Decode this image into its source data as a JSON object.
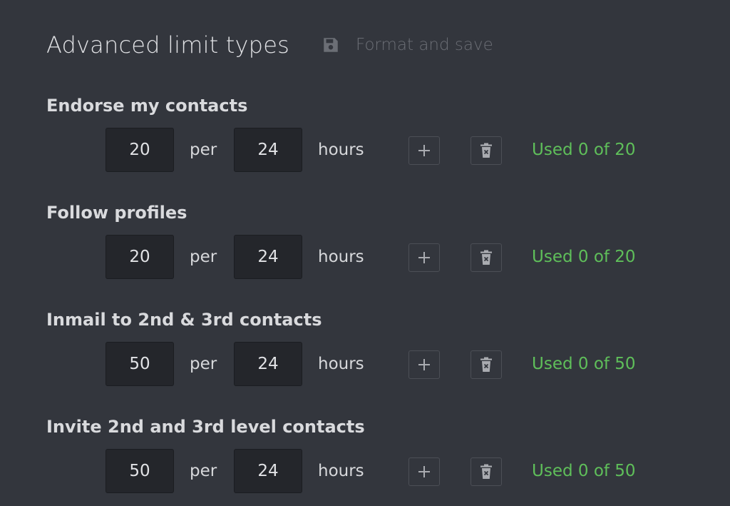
{
  "header": {
    "title": "Advanced limit types",
    "save_label": "Format and save",
    "save_icon": "floppy-disk-icon"
  },
  "labels": {
    "per": "per",
    "unit": "hours"
  },
  "limits": [
    {
      "label": "Endorse my contacts",
      "count": "20",
      "period": "24",
      "usage": "Used 0 of 20"
    },
    {
      "label": "Follow profiles",
      "count": "20",
      "period": "24",
      "usage": "Used 0 of 20"
    },
    {
      "label": "Inmail to 2nd & 3rd contacts",
      "count": "50",
      "period": "24",
      "usage": "Used 0 of 50"
    },
    {
      "label": "Invite 2nd and 3rd level contacts",
      "count": "50",
      "period": "24",
      "usage": "Used 0 of 50"
    }
  ],
  "icons": {
    "add": "plus-icon",
    "delete": "trash-icon"
  },
  "colors": {
    "background": "#33363d",
    "input_background": "#24262b",
    "usage_text": "#5fbf5a",
    "muted_text": "#6b6e75"
  }
}
